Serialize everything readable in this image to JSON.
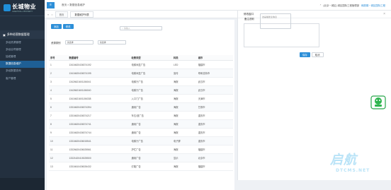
{
  "brand": {
    "name": "长城物业",
    "sub": "GREATWALL PROPERTY"
  },
  "sidebar": {
    "group": "多种经营数据管理",
    "items": [
      "多经资源管理",
      "多经合同管理",
      "抽成管理",
      "数据信息维护",
      "多经数据查询",
      "客户管理"
    ],
    "active_index": 3
  },
  "topbar": {
    "menu_icon": "menu-icon",
    "breadcrumb": "首页 > 数据信息维护",
    "org": "(北京－城区) 城区国际工程管理部",
    "user": "韩丽娟－城区国际工程"
  },
  "tabs": [
    "首页",
    "数据维护列表"
  ],
  "toolbar": {
    "add": "添加",
    "edit": "修改"
  },
  "search": {
    "placeholder": "请输入",
    "icon": "search-icon"
  },
  "filters": [
    {
      "label": "资源类别",
      "value": "请选择"
    },
    {
      "value": "请选择"
    }
  ],
  "table": {
    "headers": [
      "序号",
      "数据编号",
      "收费类型",
      "科类",
      "城市"
    ],
    "rows": [
      [
        "1",
        "13416620436374192",
        "电梯间显广告",
        "LED",
        "福建市"
      ],
      [
        "2",
        "13416620436374195",
        "电梯间显广告",
        "宣传",
        "呼和浩特市"
      ],
      [
        "3",
        "13426621601156041",
        "电梯厅广告",
        "海报",
        "武汉市"
      ],
      [
        "4",
        "13426621601156040",
        "电梯厅广告",
        "海报",
        "武汉市"
      ],
      [
        "5",
        "13416621601156338",
        "入口门广告",
        "海报",
        "天津市"
      ],
      [
        "6",
        "13316620436374394",
        "通用广告",
        "海报",
        "甘肃市"
      ],
      [
        "7",
        "13316620436374217",
        "车位/道广告",
        "海报",
        "重庆市"
      ],
      [
        "8",
        "13316620436374741",
        "通用广告",
        "海报",
        "重庆市"
      ],
      [
        "9",
        "13316620436374744",
        "通用广告",
        "海报",
        "重庆市"
      ],
      [
        "10",
        "13316620436015541",
        "电梯厅广告",
        "电子屏",
        "重庆市"
      ],
      [
        "11",
        "13326620436025561",
        "护栏广告",
        "海报",
        "福建市"
      ],
      [
        "12",
        "13321620415025500",
        "通用广告",
        "显示",
        "北京市"
      ],
      [
        "13",
        "13316610436026432",
        "灯箱广告",
        "海报",
        "福建市"
      ]
    ]
  },
  "panel": {
    "title": "修改窗口",
    "close_icon": "close-icon",
    "field_label": "备注说明",
    "field_placeholder": "这是描述主信息",
    "save": "保存",
    "cancel": "取消"
  },
  "watermark": {
    "big": "启航",
    "small": "DTCMS.NET"
  }
}
